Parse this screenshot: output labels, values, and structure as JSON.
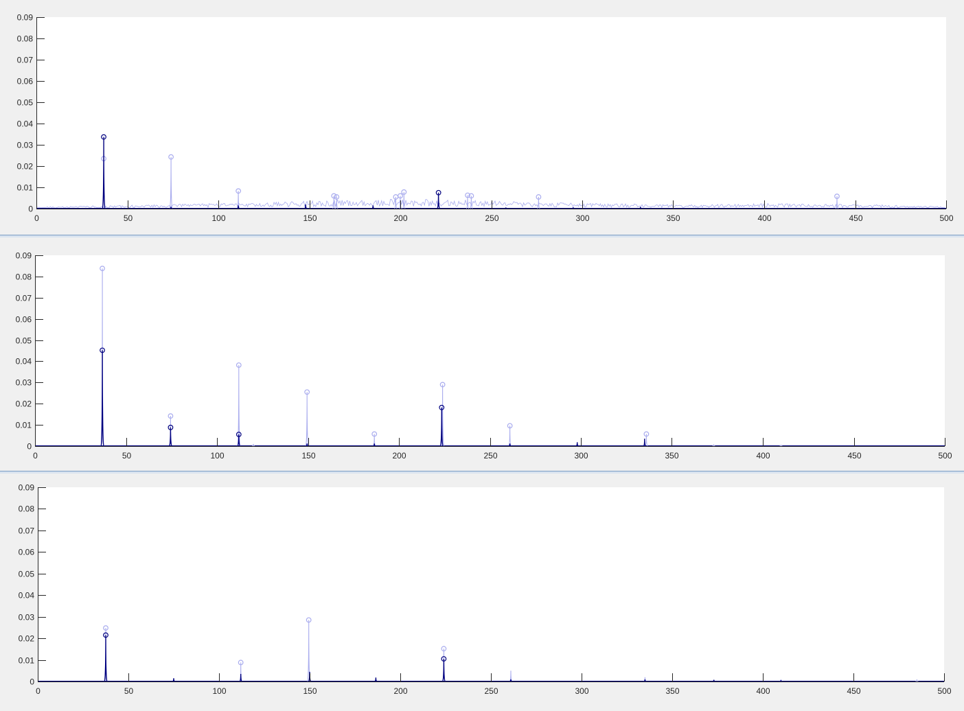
{
  "chart_data": [
    {
      "type": "line",
      "xlim": [
        0,
        500
      ],
      "ylim": [
        0,
        0.09
      ],
      "xticks": [
        "0",
        "50",
        "100",
        "150",
        "200",
        "250",
        "300",
        "350",
        "400",
        "450",
        "500"
      ],
      "yticks": [
        "0",
        "0.01",
        "0.02",
        "0.03",
        "0.04",
        "0.05",
        "0.06",
        "0.07",
        "0.08",
        "0.09"
      ],
      "colors": {
        "dark": "#00007f",
        "light": "#a9acee"
      },
      "series": [
        {
          "style": "light",
          "spikes": [
            [
              37,
              0.0235
            ],
            [
              74,
              0.0243
            ],
            [
              111,
              0.0083
            ],
            [
              163.5,
              0.006
            ],
            [
              165,
              0.0055
            ],
            [
              197.5,
              0.0055
            ],
            [
              200,
              0.006
            ],
            [
              202,
              0.0078
            ],
            [
              237,
              0.0063
            ],
            [
              239,
              0.006
            ],
            [
              276,
              0.0055
            ],
            [
              440,
              0.0058
            ]
          ],
          "peaks": [
            [
              37,
              0.0235
            ],
            [
              74,
              0.0243
            ],
            [
              111,
              0.0083
            ],
            [
              163.5,
              0.006
            ],
            [
              165,
              0.0055
            ],
            [
              197.5,
              0.0055
            ],
            [
              200,
              0.006
            ],
            [
              202,
              0.0078
            ],
            [
              237,
              0.0063
            ],
            [
              239,
              0.006
            ],
            [
              276,
              0.0055
            ],
            [
              440,
              0.0058
            ]
          ],
          "noise": [
            [
              0,
              0.0008
            ],
            [
              130,
              0.003
            ],
            [
              165,
              0.004
            ],
            [
              200,
              0.0045
            ],
            [
              240,
              0.004
            ],
            [
              275,
              0.003
            ],
            [
              360,
              0.0018
            ],
            [
              405,
              0.0025
            ],
            [
              440,
              0.0022
            ],
            [
              480,
              0.0015
            ],
            [
              500,
              0.001
            ]
          ]
        },
        {
          "style": "dark",
          "spikes": [
            [
              37,
              0.0337
            ],
            [
              74,
              0.0008
            ],
            [
              111,
              0.0015
            ],
            [
              148,
              0.002
            ],
            [
              185,
              0.0015
            ],
            [
              221,
              0.0075
            ],
            [
              258,
              0.0005
            ],
            [
              295,
              0.0006
            ],
            [
              332,
              0.0008
            ]
          ],
          "peaks": [
            [
              37,
              0.0337
            ],
            [
              221,
              0.0075
            ]
          ],
          "noise": []
        }
      ]
    },
    {
      "type": "line",
      "xlim": [
        0,
        500
      ],
      "ylim": [
        0,
        0.09
      ],
      "xticks": [
        "0",
        "50",
        "100",
        "150",
        "200",
        "250",
        "300",
        "350",
        "400",
        "450",
        "500"
      ],
      "yticks": [
        "0",
        "0.01",
        "0.02",
        "0.03",
        "0.04",
        "0.05",
        "0.06",
        "0.07",
        "0.08",
        "0.09"
      ],
      "colors": {
        "dark": "#00007f",
        "light": "#a9acee"
      },
      "series": [
        {
          "style": "light",
          "spikes": [
            [
              37,
              0.0838
            ],
            [
              74.5,
              0.0142
            ],
            [
              112,
              0.0382
            ],
            [
              149.5,
              0.0255
            ],
            [
              186.5,
              0.0057
            ],
            [
              224,
              0.029
            ],
            [
              261,
              0.0096
            ],
            [
              336,
              0.0057
            ],
            [
              120,
              0.001
            ],
            [
              373,
              0.0008
            ],
            [
              410,
              0.0006
            ]
          ],
          "peaks": [
            [
              37,
              0.0838
            ],
            [
              74.5,
              0.0142
            ],
            [
              112,
              0.0382
            ],
            [
              149.5,
              0.0255
            ],
            [
              186.5,
              0.0057
            ],
            [
              224,
              0.029
            ],
            [
              261,
              0.0096
            ],
            [
              336,
              0.0057
            ]
          ],
          "noise": [
            [
              0,
              0.0002
            ],
            [
              500,
              0.0002
            ]
          ]
        },
        {
          "style": "dark",
          "spikes": [
            [
              37,
              0.0452
            ],
            [
              74.5,
              0.0088
            ],
            [
              112,
              0.0055
            ],
            [
              149.5,
              0.0012
            ],
            [
              186.5,
              0.0012
            ],
            [
              223.5,
              0.0182
            ],
            [
              261,
              0.0012
            ],
            [
              298,
              0.0018
            ],
            [
              335,
              0.0035
            ]
          ],
          "peaks": [
            [
              37,
              0.0452
            ],
            [
              74.5,
              0.0088
            ],
            [
              112,
              0.0055
            ],
            [
              223.5,
              0.0182
            ]
          ],
          "noise": []
        }
      ]
    },
    {
      "type": "line",
      "xlim": [
        0,
        500
      ],
      "ylim": [
        0,
        0.09
      ],
      "xticks": [
        "0",
        "50",
        "100",
        "150",
        "200",
        "250",
        "300",
        "350",
        "400",
        "450",
        "500"
      ],
      "yticks": [
        "0",
        "0.01",
        "0.02",
        "0.03",
        "0.04",
        "0.05",
        "0.06",
        "0.07",
        "0.08",
        "0.09"
      ],
      "colors": {
        "dark": "#00007f",
        "light": "#a9acee"
      },
      "series": [
        {
          "style": "light",
          "spikes": [
            [
              37.5,
              0.0248
            ],
            [
              112,
              0.0088
            ],
            [
              149.5,
              0.0285
            ],
            [
              224,
              0.0152
            ],
            [
              75,
              0.0015
            ],
            [
              261,
              0.005
            ],
            [
              335,
              0.002
            ],
            [
              410,
              0.001
            ],
            [
              485,
              0.001
            ]
          ],
          "peaks": [
            [
              37.5,
              0.0248
            ],
            [
              112,
              0.0088
            ],
            [
              149.5,
              0.0285
            ],
            [
              224,
              0.0152
            ]
          ],
          "noise": [
            [
              0,
              0.0002
            ],
            [
              500,
              0.0002
            ]
          ]
        },
        {
          "style": "dark",
          "spikes": [
            [
              37.5,
              0.0215
            ],
            [
              75,
              0.0015
            ],
            [
              112,
              0.0035
            ],
            [
              150,
              0.0045
            ],
            [
              186.5,
              0.0018
            ],
            [
              224,
              0.0105
            ],
            [
              261,
              0.001
            ],
            [
              335,
              0.001
            ],
            [
              373,
              0.0008
            ],
            [
              410,
              0.0006
            ]
          ],
          "peaks": [
            [
              37.5,
              0.0215
            ],
            [
              224,
              0.0105
            ]
          ],
          "noise": []
        }
      ]
    }
  ]
}
